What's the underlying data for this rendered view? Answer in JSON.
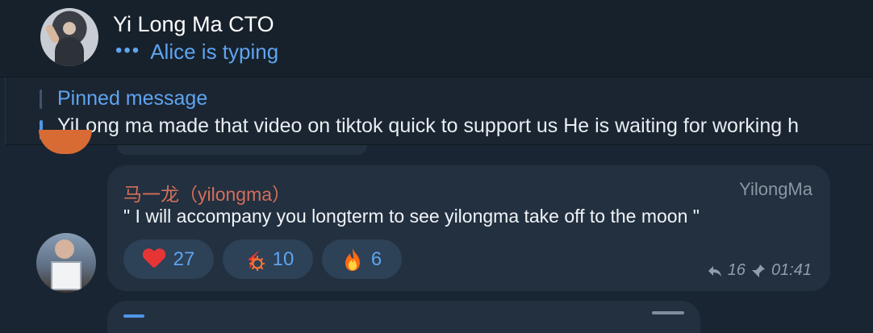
{
  "header": {
    "title": "Yi Long Ma CTO",
    "typing_dots": "•••",
    "typing_status": "Alice is typing"
  },
  "pinned": {
    "title": "Pinned message",
    "text": "YiLong ma made that video on tiktok quick to support us  He is waiting for working h"
  },
  "message": {
    "sender_name": "马一龙（yilongma）",
    "sender_handle": "YilongMa",
    "text": "\" I will accompany you longterm to see yilongma take off to the moon \"",
    "reactions": [
      {
        "icon": "heart-emoji",
        "count": "27"
      },
      {
        "icon": "spark-emoji",
        "count": "10"
      },
      {
        "icon": "fire-emoji",
        "count": "6"
      }
    ],
    "reply_count": "16",
    "time": "01:41"
  },
  "colors": {
    "accent": "#5ea4f1",
    "sender": "#d56e59",
    "background": "#1a2533",
    "bubble": "#223040",
    "reaction_bg": "#2d4157"
  }
}
